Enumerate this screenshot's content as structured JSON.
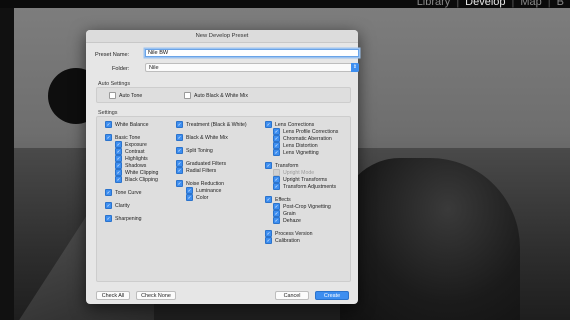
{
  "app": {
    "modules": [
      "Library",
      "Develop",
      "Map",
      "B"
    ],
    "active_module": "Develop"
  },
  "dialog": {
    "title": "New Develop Preset",
    "preset_name_label": "Preset Name:",
    "preset_name_value": "Nile BW",
    "folder_label": "Folder:",
    "folder_value": "Nile",
    "auto_settings": {
      "title": "Auto Settings",
      "items": [
        {
          "label": "Auto Tone",
          "checked": false
        },
        {
          "label": "Auto Black & White Mix",
          "checked": false
        }
      ]
    },
    "settings": {
      "title": "Settings",
      "col1": [
        {
          "label": "White Balance",
          "checked": true
        },
        {
          "label": "Basic Tone",
          "checked": true
        },
        {
          "label": "Exposure",
          "checked": true
        },
        {
          "label": "Contrast",
          "checked": true
        },
        {
          "label": "Highlights",
          "checked": true
        },
        {
          "label": "Shadows",
          "checked": true
        },
        {
          "label": "White Clipping",
          "checked": true
        },
        {
          "label": "Black Clipping",
          "checked": true
        },
        {
          "label": "Tone Curve",
          "checked": true
        },
        {
          "label": "Clarity",
          "checked": true
        },
        {
          "label": "Sharpening",
          "checked": true
        }
      ],
      "col2": [
        {
          "label": "Treatment (Black & White)",
          "checked": true
        },
        {
          "label": "Black & White Mix",
          "checked": true
        },
        {
          "label": "Split Toning",
          "checked": true
        },
        {
          "label": "Graduated Filters",
          "checked": true
        },
        {
          "label": "Radial Filters",
          "checked": true
        },
        {
          "label": "Noise Reduction",
          "checked": true
        },
        {
          "label": "Luminance",
          "checked": true
        },
        {
          "label": "Color",
          "checked": true
        }
      ],
      "col3": [
        {
          "label": "Lens Corrections",
          "checked": true
        },
        {
          "label": "Lens Profile Corrections",
          "checked": true
        },
        {
          "label": "Chromatic Aberration",
          "checked": true
        },
        {
          "label": "Lens Distortion",
          "checked": true
        },
        {
          "label": "Lens Vignetting",
          "checked": true
        },
        {
          "label": "Transform",
          "checked": true
        },
        {
          "label": "Upright Mode",
          "checked": false
        },
        {
          "label": "Upright Transforms",
          "checked": true
        },
        {
          "label": "Transform Adjustments",
          "checked": true
        },
        {
          "label": "Effects",
          "checked": true
        },
        {
          "label": "Post-Crop Vignetting",
          "checked": true
        },
        {
          "label": "Grain",
          "checked": true
        },
        {
          "label": "Dehaze",
          "checked": true
        },
        {
          "label": "Process Version",
          "checked": true
        },
        {
          "label": "Calibration",
          "checked": true
        }
      ]
    },
    "buttons": {
      "check_all": "Check All",
      "check_none": "Check None",
      "cancel": "Cancel",
      "create": "Create"
    }
  },
  "colors": {
    "accent": "#3d8ef0",
    "dialog_bg": "#e6e6e6"
  }
}
